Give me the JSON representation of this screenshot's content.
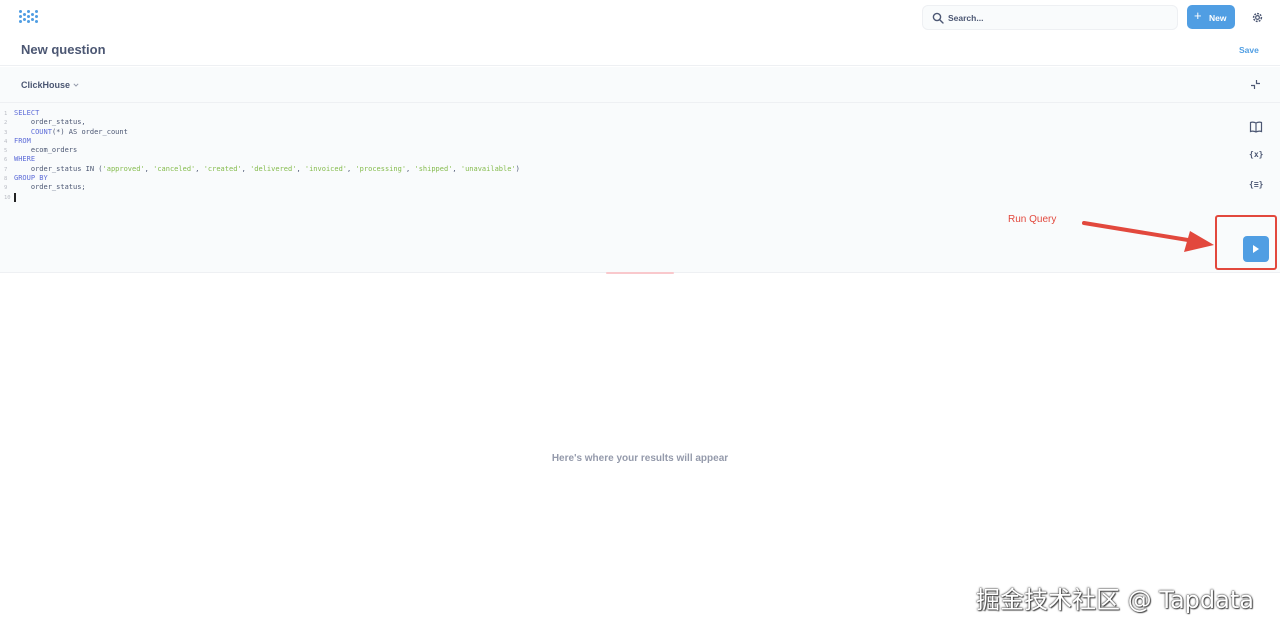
{
  "header": {
    "logo_icon": "metabase-logo",
    "title": "New question",
    "search_placeholder": "Search...",
    "new_button_label": "New",
    "save_label": "Save"
  },
  "database": {
    "name": "ClickHouse"
  },
  "editor": {
    "lines": [
      {
        "num": "1",
        "tokens": [
          {
            "t": "SELECT",
            "c": "kw"
          }
        ]
      },
      {
        "num": "2",
        "tokens": [
          {
            "t": "    order_status,",
            "c": "txt"
          }
        ]
      },
      {
        "num": "3",
        "tokens": [
          {
            "t": "    ",
            "c": "txt"
          },
          {
            "t": "COUNT",
            "c": "kw"
          },
          {
            "t": "(*) AS order_count",
            "c": "txt"
          }
        ]
      },
      {
        "num": "4",
        "tokens": [
          {
            "t": "FROM",
            "c": "kw"
          }
        ]
      },
      {
        "num": "5",
        "tokens": [
          {
            "t": "    ecom_orders",
            "c": "txt"
          }
        ]
      },
      {
        "num": "6",
        "tokens": [
          {
            "t": "WHERE",
            "c": "kw"
          }
        ]
      },
      {
        "num": "7",
        "tokens": [
          {
            "t": "    order_status IN (",
            "c": "txt"
          },
          {
            "t": "'approved'",
            "c": "str"
          },
          {
            "t": ", ",
            "c": "txt"
          },
          {
            "t": "'canceled'",
            "c": "str"
          },
          {
            "t": ", ",
            "c": "txt"
          },
          {
            "t": "'created'",
            "c": "str"
          },
          {
            "t": ", ",
            "c": "txt"
          },
          {
            "t": "'delivered'",
            "c": "str"
          },
          {
            "t": ", ",
            "c": "txt"
          },
          {
            "t": "'invoiced'",
            "c": "str"
          },
          {
            "t": ", ",
            "c": "txt"
          },
          {
            "t": "'processing'",
            "c": "str"
          },
          {
            "t": ", ",
            "c": "txt"
          },
          {
            "t": "'shipped'",
            "c": "str"
          },
          {
            "t": ", ",
            "c": "txt"
          },
          {
            "t": "'unavailable'",
            "c": "str"
          },
          {
            "t": ")",
            "c": "txt"
          }
        ]
      },
      {
        "num": "8",
        "tokens": [
          {
            "t": "GROUP BY",
            "c": "kw"
          }
        ]
      },
      {
        "num": "9",
        "tokens": [
          {
            "t": "    order_status;",
            "c": "txt"
          }
        ]
      },
      {
        "num": "10",
        "tokens": []
      }
    ],
    "side_icons": {
      "reference": "book-icon",
      "variables": "{x}",
      "snippets": "{≡}"
    }
  },
  "annotation": {
    "run_query_label": "Run Query",
    "color": "#e2483d"
  },
  "results": {
    "placeholder": "Here's where your results will appear"
  },
  "watermark": "掘金技术社区 @ Tapdata",
  "colors": {
    "brand": "#509ee3",
    "keyword": "#5d6cd8",
    "string": "#84bb4c",
    "annotation": "#e2483d"
  }
}
